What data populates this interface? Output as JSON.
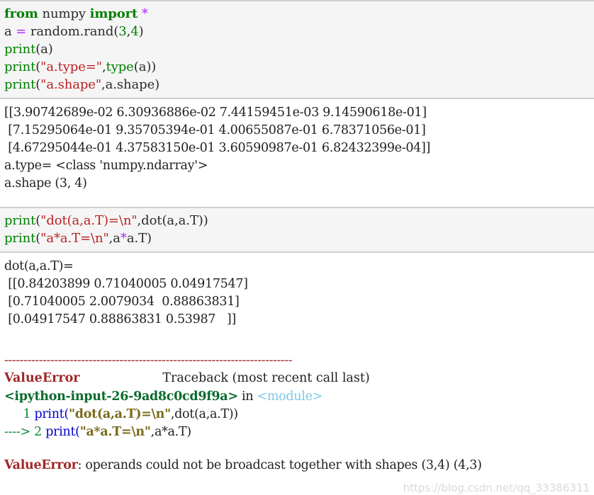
{
  "notebook": {
    "kind": "jupyter-ipython-console-output",
    "cells": [
      {
        "type": "input",
        "lines": [
          {
            "tokens": [
              {
                "t": "from",
                "c": "k"
              },
              {
                "t": " ",
                "c": "pn"
              },
              {
                "t": "numpy",
                "c": "nm"
              },
              {
                "t": " ",
                "c": "pn"
              },
              {
                "t": "import",
                "c": "k"
              },
              {
                "t": " ",
                "c": "pn"
              },
              {
                "t": "*",
                "c": "op"
              }
            ]
          },
          {
            "tokens": [
              {
                "t": "a ",
                "c": "nm"
              },
              {
                "t": "=",
                "c": "op"
              },
              {
                "t": " random.rand",
                "c": "nm"
              },
              {
                "t": "(",
                "c": "pn"
              },
              {
                "t": "3",
                "c": "no"
              },
              {
                "t": ",",
                "c": "pn"
              },
              {
                "t": "4",
                "c": "no"
              },
              {
                "t": ")",
                "c": "pn"
              }
            ]
          },
          {
            "tokens": [
              {
                "t": "print",
                "c": "bi"
              },
              {
                "t": "(",
                "c": "pn"
              },
              {
                "t": "a",
                "c": "nm"
              },
              {
                "t": ")",
                "c": "pn"
              }
            ]
          },
          {
            "tokens": [
              {
                "t": "print",
                "c": "bi"
              },
              {
                "t": "(",
                "c": "pn"
              },
              {
                "t": "\"a.type=\"",
                "c": "st"
              },
              {
                "t": ",",
                "c": "pn"
              },
              {
                "t": "type",
                "c": "bi"
              },
              {
                "t": "(",
                "c": "pn"
              },
              {
                "t": "a",
                "c": "nm"
              },
              {
                "t": "))",
                "c": "pn"
              }
            ]
          },
          {
            "tokens": [
              {
                "t": "print",
                "c": "bi"
              },
              {
                "t": "(",
                "c": "pn"
              },
              {
                "t": "\"a.shape\"",
                "c": "st"
              },
              {
                "t": ",",
                "c": "pn"
              },
              {
                "t": "a.shape",
                "c": "nm"
              },
              {
                "t": ")",
                "c": "pn"
              }
            ]
          }
        ]
      },
      {
        "type": "output",
        "lines": [
          "[[3.90742689e-02 6.30936886e-02 7.44159451e-03 9.14590618e-01]",
          " [7.15295064e-01 9.35705394e-01 4.00655087e-01 6.78371056e-01]",
          " [4.67295044e-01 4.37583150e-01 3.60590987e-01 6.82432399e-04]]",
          "a.type= <class 'numpy.ndarray'>",
          "a.shape (3, 4)"
        ]
      },
      {
        "type": "input",
        "lines": [
          {
            "tokens": [
              {
                "t": "print",
                "c": "bi"
              },
              {
                "t": "(",
                "c": "pn"
              },
              {
                "t": "\"dot(a,a.T)=\\n\"",
                "c": "st"
              },
              {
                "t": ",",
                "c": "pn"
              },
              {
                "t": "dot",
                "c": "nm"
              },
              {
                "t": "(",
                "c": "pn"
              },
              {
                "t": "a,a.T",
                "c": "nm"
              },
              {
                "t": "))",
                "c": "pn"
              }
            ]
          },
          {
            "tokens": [
              {
                "t": "print",
                "c": "bi"
              },
              {
                "t": "(",
                "c": "pn"
              },
              {
                "t": "\"a*a.T=\\n\"",
                "c": "st"
              },
              {
                "t": ",",
                "c": "pn"
              },
              {
                "t": "a",
                "c": "nm"
              },
              {
                "t": "*",
                "c": "op"
              },
              {
                "t": "a.T",
                "c": "nm"
              },
              {
                "t": ")",
                "c": "pn"
              }
            ]
          }
        ]
      },
      {
        "type": "output",
        "lines": [
          "dot(a,a.T)=",
          " [[0.84203899 0.71040005 0.04917547]",
          " [0.71040005 2.0079034  0.88863831]",
          " [0.04917547 0.88863831 0.53987   ]]"
        ]
      }
    ],
    "traceback": {
      "rule": "---------------------------------------------------------------------------",
      "error_name": "ValueError",
      "header_right": "Traceback (most recent call last)",
      "location_file": "<ipython-input-26-9ad8c0cd9f9a>",
      "location_in": " in ",
      "location_scope": "<module>",
      "frames": [
        {
          "marker": "     ",
          "lineno": "1",
          "tokens": [
            {
              "t": " ",
              "c": "tb-code-pl"
            },
            {
              "t": "print",
              "c": "tb-code-kw"
            },
            {
              "t": "(",
              "c": "tb-code-op"
            },
            {
              "t": "\"dot(a,a.T)=\\n\"",
              "c": "tb-code-str"
            },
            {
              "t": ",",
              "c": "tb-code-pl"
            },
            {
              "t": "dot(a,a.T))",
              "c": "tb-code-pl"
            }
          ]
        },
        {
          "marker": "----> ",
          "lineno": "2",
          "tokens": [
            {
              "t": " ",
              "c": "tb-code-pl"
            },
            {
              "t": "print",
              "c": "tb-code-kw"
            },
            {
              "t": "(",
              "c": "tb-code-op"
            },
            {
              "t": "\"a*a.T=\\n\"",
              "c": "tb-code-str"
            },
            {
              "t": ",",
              "c": "tb-code-pl"
            },
            {
              "t": "a*a.T)",
              "c": "tb-code-pl"
            }
          ]
        }
      ],
      "final_error_name": "ValueError",
      "final_message": ": operands could not be broadcast together with shapes (3,4) (4,3) "
    }
  },
  "watermark": "https://blog.csdn.net/qq_33386311",
  "colors": {
    "cell_bg": "#f5f5f5",
    "cell_border": "#cfcfcf",
    "page_bg": "#ffffff",
    "keyword": "#007f00",
    "operator": "#aa22ff",
    "builtin": "#008000",
    "string": "#ba2121",
    "number": "#008000",
    "error": "#a12828",
    "tb_file": "#0a6b2e",
    "tb_module": "#7ec7e8",
    "tb_lineno": "#0a8a37",
    "tb_code_keyword": "#0000cc",
    "tb_code_string": "#7a6a1a",
    "watermark": "#d9d9d9"
  }
}
